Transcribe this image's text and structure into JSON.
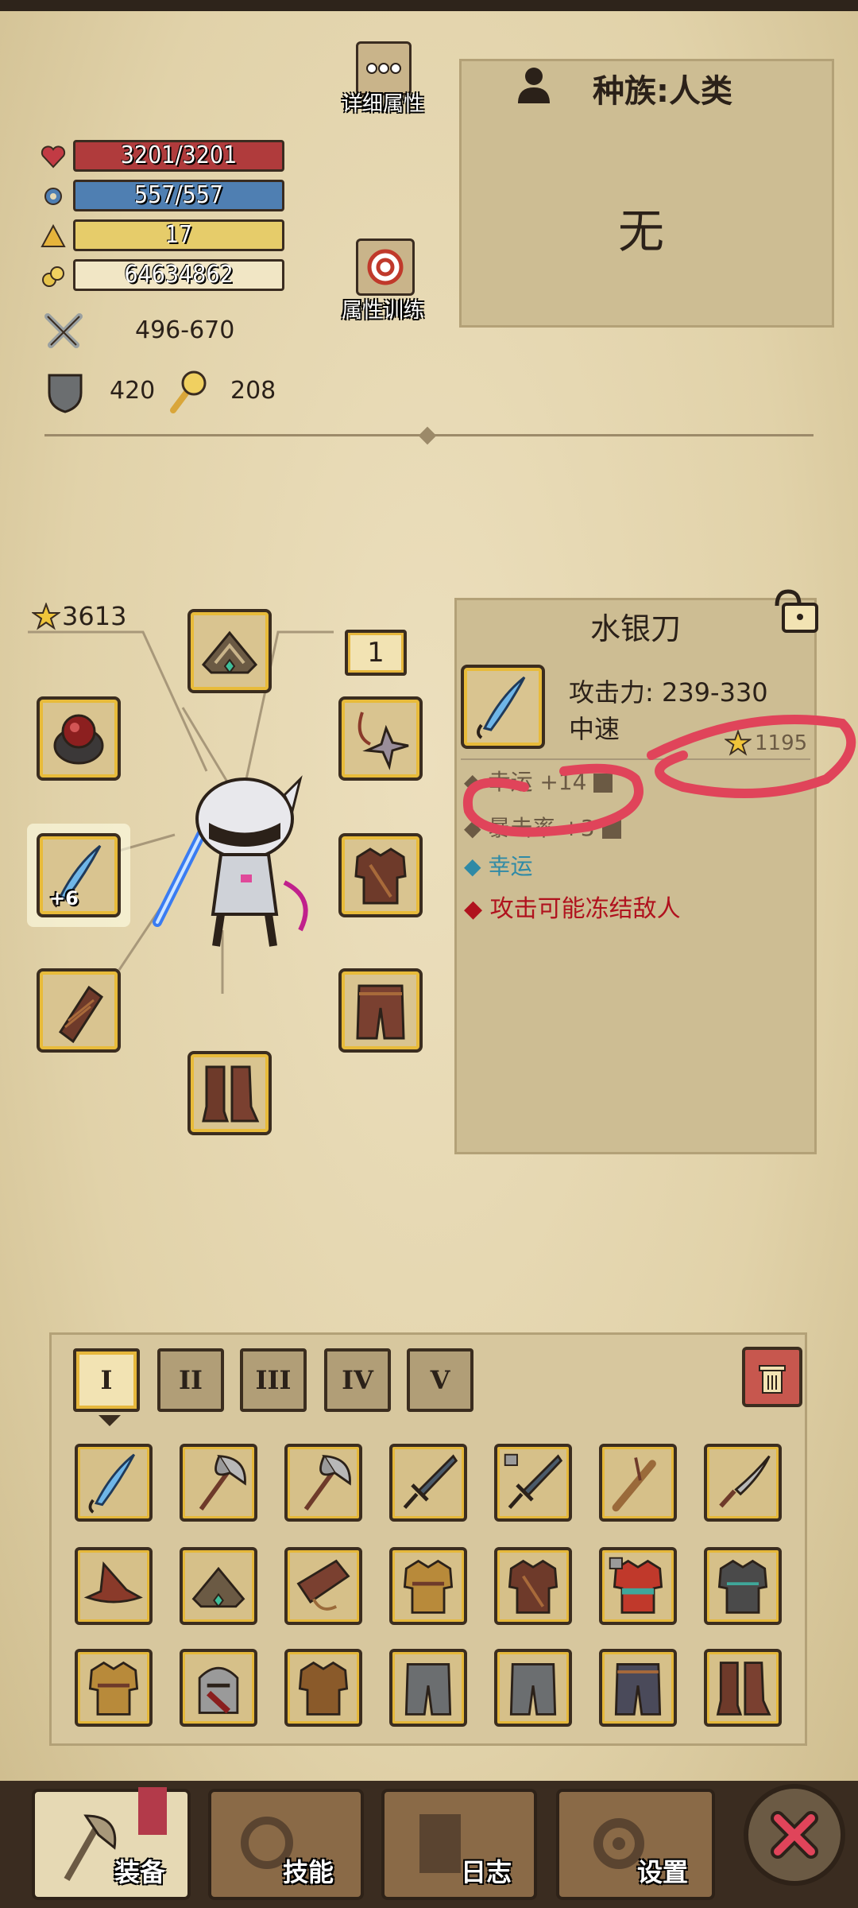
{
  "header": {
    "detail_attr_label": "详细属性",
    "train_attr_label": "属性训练"
  },
  "stats": {
    "hp": "3201/3201",
    "mp": "557/557",
    "level": "17",
    "gold": "64634862",
    "attack": "496-670",
    "defense": "420",
    "magic": "208"
  },
  "race_panel": {
    "title": "种族:人类",
    "value": "无"
  },
  "equipment": {
    "score": "3613",
    "ring_slot_count": "1",
    "weapon_enhance": "+6"
  },
  "item_panel": {
    "name": "水银刀",
    "attack": "攻击力: 239-330",
    "speed": "中速",
    "score": "1195",
    "attr1": "幸运 +14",
    "attr2": "暴击率 +3",
    "attr3": "幸运",
    "effect": "攻击可能冻结敌人"
  },
  "inventory": {
    "tabs": [
      "I",
      "II",
      "III",
      "IV",
      "V"
    ]
  },
  "nav": {
    "equip": "装备",
    "skills": "技能",
    "log": "日志",
    "settings": "设置"
  },
  "colors": {
    "hp": "#b03b3c",
    "mp": "#4f7fb2",
    "level": "#e6cc6a",
    "gold_bar": "#f1e6c5",
    "slot_border": "#e8bb3a",
    "highlight_text": "#2f8aa6",
    "effect_text": "#b0121e",
    "annotation": "#e0445a"
  }
}
